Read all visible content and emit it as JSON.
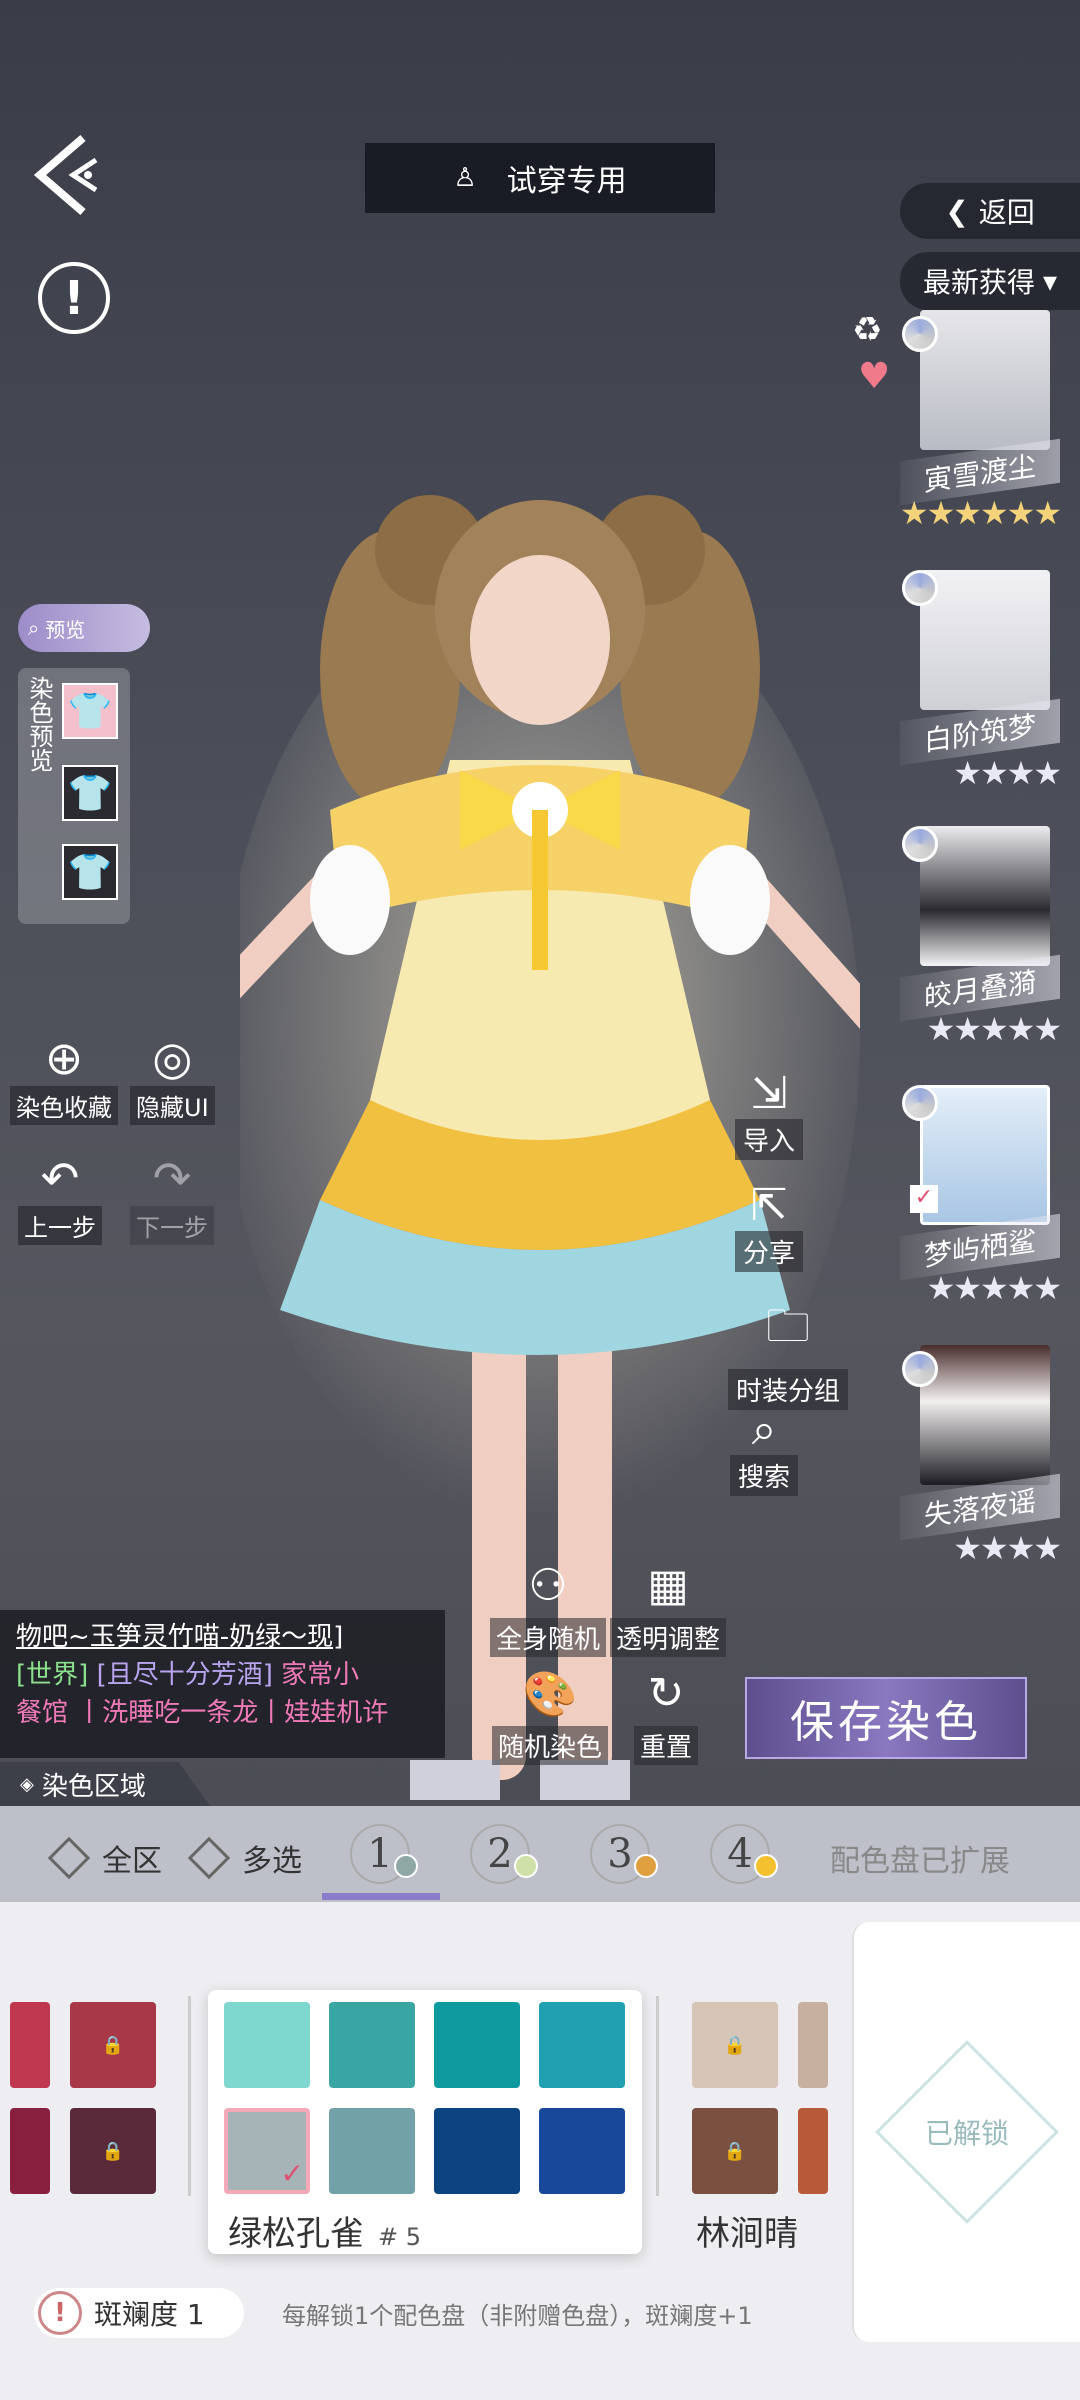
{
  "header": {
    "title": "试穿专用",
    "return_label": "返回",
    "sort_label": "最新获得"
  },
  "left_panel": {
    "preview_label": "预览",
    "dye_preview_label": "染色预览",
    "tools": [
      {
        "label": "染色收藏"
      },
      {
        "label": "隐藏UI"
      },
      {
        "label": "上一步"
      },
      {
        "label": "下一步"
      }
    ]
  },
  "outfits": [
    {
      "name": "寅雪渡尘",
      "stars": "★★★★★★",
      "color": "#d8d8dc"
    },
    {
      "name": "白阶筑梦",
      "stars": "★★★★",
      "color": "#e9e9ee"
    },
    {
      "name": "皎月叠漪",
      "stars": "★★★★★",
      "color": "#cfcfd5"
    },
    {
      "name": "梦屿栖鲨",
      "stars": "★★★★★",
      "color": "#cfe1f0"
    },
    {
      "name": "失落夜谣",
      "stars": "★★★★",
      "color": "#d9d0d0"
    }
  ],
  "right_tools": [
    {
      "label": "导入"
    },
    {
      "label": "分享"
    },
    {
      "label": "时装分组"
    },
    {
      "label": "搜索"
    }
  ],
  "chat": {
    "line1": "物吧~玉笋灵竹喵-奶绿～现]",
    "world": "[世界]",
    "line2_user": "[且尽十分芳酒]",
    "line2_msg": "家常小",
    "line3_a": "餐馆",
    "line3_b": "丨洗睡吃一条龙丨娃娃机许"
  },
  "center_tools": [
    {
      "label": "全身随机"
    },
    {
      "label": "透明调整"
    },
    {
      "label": "随机染色"
    },
    {
      "label": "重置"
    }
  ],
  "save_label": "保存染色",
  "dye_region_label": "染色区域",
  "palette_bar": {
    "all_label": "全区",
    "multi_label": "多选",
    "tabs": [
      {
        "num": "1",
        "color": "#8fa8a6"
      },
      {
        "num": "2",
        "color": "#cfe0a8"
      },
      {
        "num": "3",
        "color": "#e0a040"
      },
      {
        "num": "4",
        "color": "#f3c030"
      }
    ],
    "expanded_label": "配色盘已扩展"
  },
  "palettes": {
    "selected": {
      "name": "绿松孔雀",
      "index": "# 5",
      "colors": [
        "#7fd8d0",
        "#3aa6a4",
        "#0e9a9f",
        "#20a0b0",
        "#a6b4b8",
        "#72a2a8",
        "#0b4480",
        "#18489a"
      ]
    },
    "left": {
      "colors": [
        "#c03850",
        "#a83848",
        "#8a2040",
        "#5a2a3a"
      ]
    },
    "right": {
      "name": "林涧晴",
      "colors": [
        "#d6c4b6",
        "#c8b0a0",
        "#7a5040",
        "#b85a3a"
      ]
    }
  },
  "unlock_label": "已解锁",
  "footer": {
    "badge": "斑斓度 1",
    "hint": "每解锁1个配色盘（非附赠色盘），斑斓度+1"
  }
}
